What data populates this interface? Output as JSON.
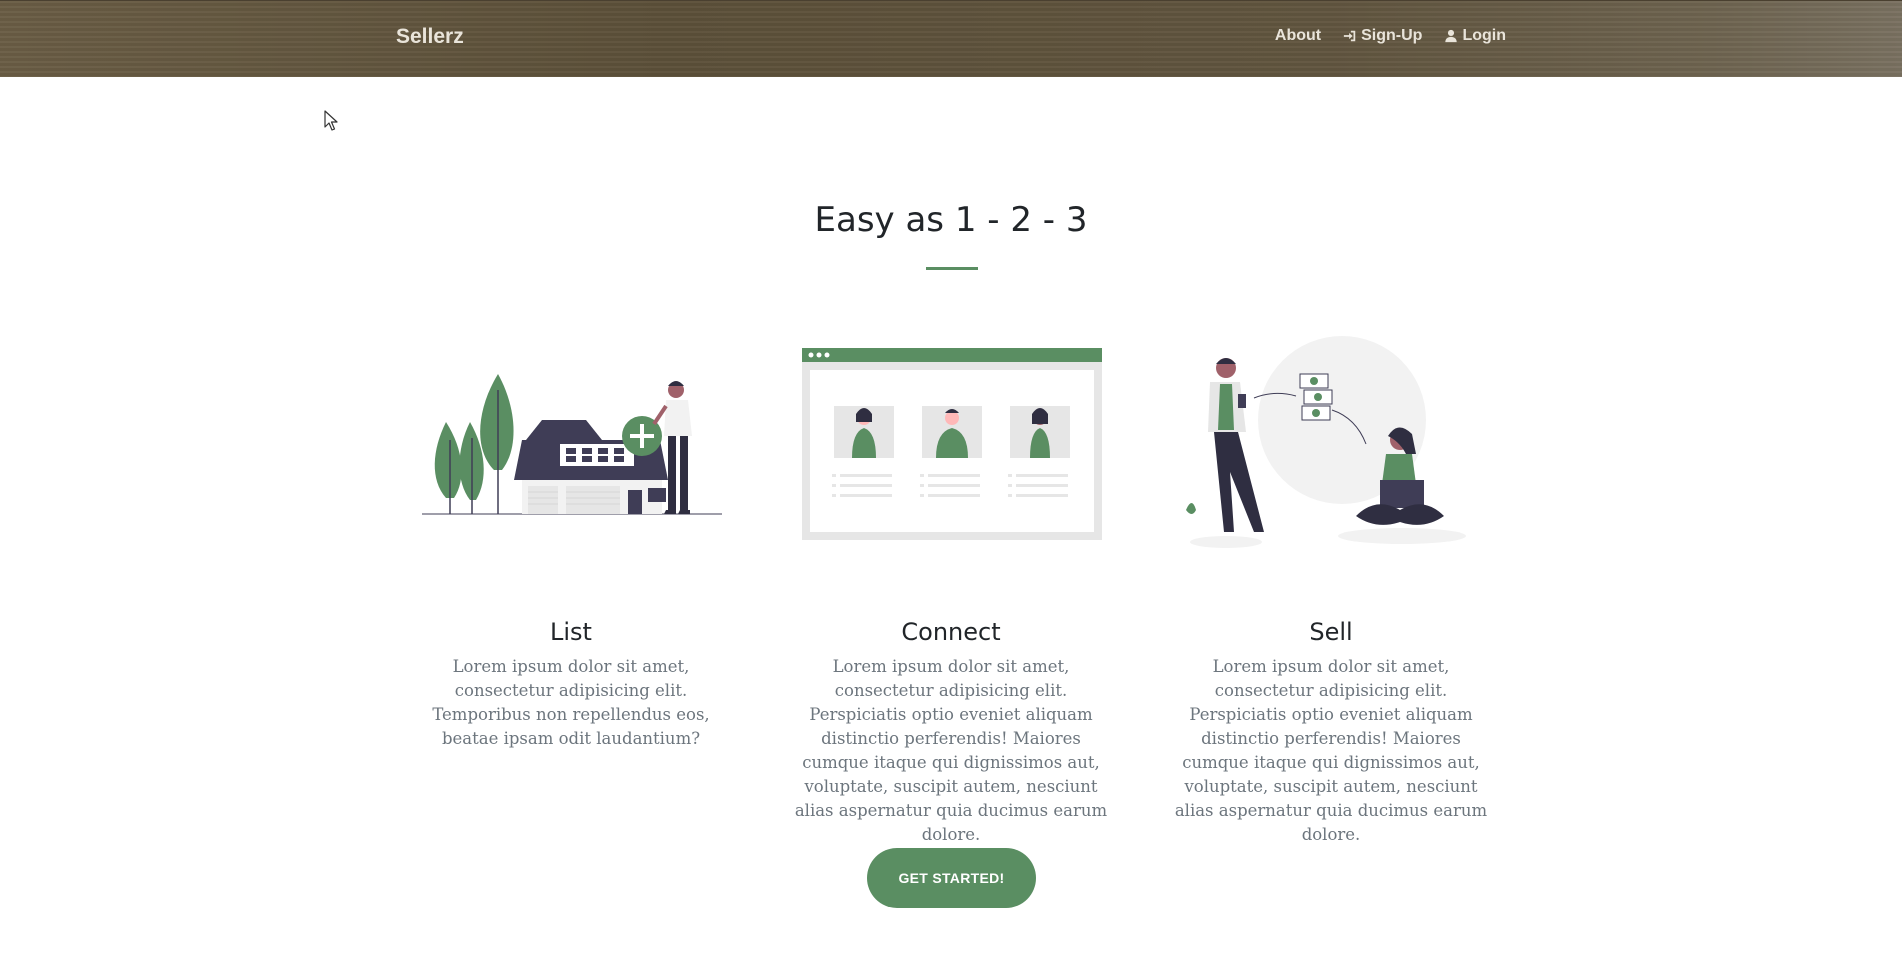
{
  "navbar": {
    "brand": "Sellerz",
    "links": [
      {
        "label": "About",
        "icon": "none"
      },
      {
        "label": "Sign-Up",
        "icon": "sign-in-icon"
      },
      {
        "label": "Login",
        "icon": "user-icon"
      }
    ]
  },
  "section": {
    "title": "Easy as 1 - 2 - 3"
  },
  "steps": [
    {
      "title": "List",
      "text": "Lorem ipsum dolor sit amet, consectetur adipisicing elit. Temporibus non repellendus eos, beatae ipsam odit laudantium?",
      "illustration": "house-with-plus-illustration"
    },
    {
      "title": "Connect",
      "text": "Lorem ipsum dolor sit amet, consectetur adipisicing elit. Perspiciatis optio eveniet aliquam distinctio perferendis! Maiores cumque itaque qui dignissimos aut, voluptate, suscipit autem, nesciunt alias aspernatur quia ducimus earum dolore.",
      "illustration": "browser-profiles-illustration"
    },
    {
      "title": "Sell",
      "text": "Lorem ipsum dolor sit amet, consectetur adipisicing elit. Perspiciatis optio eveniet aliquam distinctio perferendis! Maiores cumque itaque qui dignissimos aut, voluptate, suscipit autem, nesciunt alias aspernatur quia ducimus earum dolore.",
      "illustration": "money-transfer-illustration"
    }
  ],
  "cta": {
    "label": "GET STARTED!"
  },
  "colors": {
    "accent": "#5a8e62",
    "navbar": "#5f5440",
    "dark": "#3f3d56"
  }
}
